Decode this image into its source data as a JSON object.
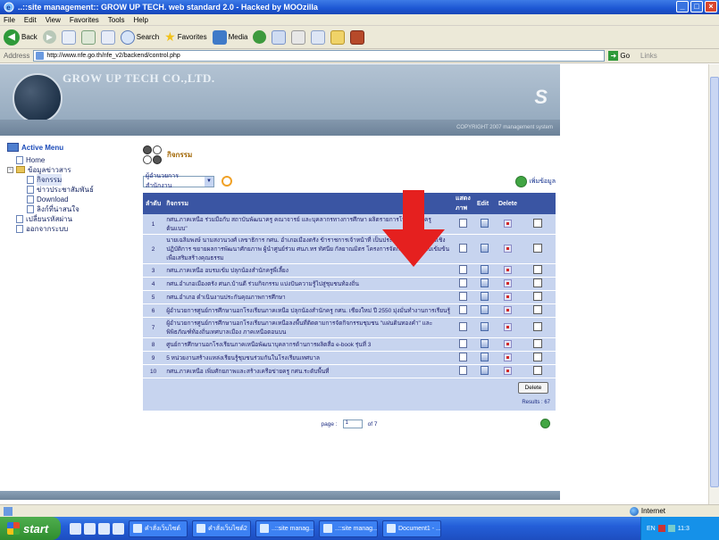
{
  "window": {
    "title": "..::site management:: GROW UP TECH. web standard 2.0 - Hacked by MOOzilla",
    "controls": [
      "_",
      "□",
      "×"
    ]
  },
  "menubar": [
    "File",
    "Edit",
    "View",
    "Favorites",
    "Tools",
    "Help"
  ],
  "toolbar": {
    "back": "Back",
    "search": "Search",
    "favorites": "Favorites",
    "media": "Media"
  },
  "address": {
    "label": "Address",
    "url": "http://www.nfe.go.th/nfe_v2/backend/control.php",
    "go": "Go",
    "links": "Links"
  },
  "site": {
    "logo_text": "GROW UP TECH CO.,LTD.",
    "s_mark": "S",
    "copyright": "COPYRIGHT 2007 management system"
  },
  "sidebar": {
    "title": "Active Menu",
    "items": [
      {
        "label": "Home",
        "level": 1
      },
      {
        "label": "ข้อมูลข่าวสาร",
        "level": 1
      },
      {
        "label": "กิจกรรม",
        "level": 2,
        "selected": true
      },
      {
        "label": "ข่าวประชาสัมพันธ์",
        "level": 2
      },
      {
        "label": "Download",
        "level": 2
      },
      {
        "label": "ลิงก์ที่น่าสนใจ",
        "level": 2
      },
      {
        "label": "เปลี่ยนรหัสผ่าน",
        "level": 1
      },
      {
        "label": "ออกจากระบบ",
        "level": 1
      }
    ]
  },
  "content": {
    "crumb": "กิจกรรม",
    "filter_value": "ผู้อำนวยการสำนักงาน",
    "add_label": "เพิ่มข้อมูล",
    "columns": {
      "no": "ลำดับ",
      "title": "กิจกรรม",
      "view": "แสดงภาพ",
      "edit": "Edit",
      "delete": "Delete"
    },
    "rows": [
      {
        "no": "1",
        "title": "กศน.ภาคเหนือ ร่วมมือกับ สถาบันพัฒนาครู คณาจารย์ และบุคลากรทางการศึกษา ผลิตรายการโทรทัศน์ \"ครูต้นแบบ\""
      },
      {
        "no": "2",
        "title": "นายเฉลิมพงษ์ นามสงวนวงศ์ เลขาธิการ กศน. อำเภอเมืองตรัง ข้าราชการเจ้าหน้าที่ เป็นประธานเปิดการอบรมเชิงปฏิบัติการ ขยายผลการพัฒนาศักยภาพ ผู้นำศูนย์ร่วม ศนภ.ทร ทัศนีย กัลยาณมิตร โครงการจัดการศึกษาแบบเข้มข้นเพื่อเสริมสร้างคุณธรรม"
      },
      {
        "no": "3",
        "title": "กศน.ภาคเหนือ อบรมเข้ม ปลุกน้องสำนักครูพี่เลี้ยง"
      },
      {
        "no": "4",
        "title": "กศน.อำเภอเมืองตรัง ศนภ.บ้านดี ร่วมกิจกรรม แบ่งปันความรู้ไปสู่ชุมชนท้องถิ่น"
      },
      {
        "no": "5",
        "title": "กศน.อำเภอ ดำเนินงานประกันคุณภาพการศึกษา"
      },
      {
        "no": "6",
        "title": "ผู้อำนวยการศูนย์การศึกษานอกโรงเรียนภาคเหนือ ปลุกน้องสำนักครู กศน. เชียงใหม่ ปี 2550 มุ่งมั่นทำงานการเรียนรู้"
      },
      {
        "no": "7",
        "title": "ผู้อำนวยการศูนย์การศึกษานอกโรงเรียนภาคเหนือลงพื้นที่ติดตามการจัดกิจกรรมชุมชน \"แผ่นดินทองคำ\" และพิพิธภัณฑ์ท้องถิ่นเทศบาลเมือง ภาคเหนือตอนบน"
      },
      {
        "no": "8",
        "title": "ศูนย์การศึกษานอกโรงเรียนภาคเหนือพัฒนาบุคลากรด้านการผลิตสื่อ e-book รุ่นที่ 3"
      },
      {
        "no": "9",
        "title": "5 หน่วยงานสร้างแหล่งเรียนรู้ชุมชนร่วมกันในโรงเรียนเทศบาล"
      },
      {
        "no": "10",
        "title": "กศน.ภาคเหนือ เพิ่มศักยภาพและสร้างเครือข่ายครู กศน.ระดับพื้นที่"
      }
    ],
    "delete_button": "Delete",
    "results": "Results : 67",
    "page_label": "page : ",
    "page_value": "1",
    "page_of": "of 7"
  },
  "statusbar": {
    "zone": "Internet"
  },
  "taskbar": {
    "start": "start",
    "tasks": [
      "คำสั่งเว็บไซต์",
      "คำสั่งเว็บไซต์2",
      "..::site manag...",
      "..::site manag...",
      "Document1 - ..."
    ],
    "tray_lang": "EN",
    "clock": "11:3"
  },
  "colors": {
    "title_bar": "#1c56d3",
    "table_header": "#3a55a3",
    "row_bg": "#c7d4ef",
    "arrow": "#e5201f",
    "start_green": "#3a9a3a"
  }
}
